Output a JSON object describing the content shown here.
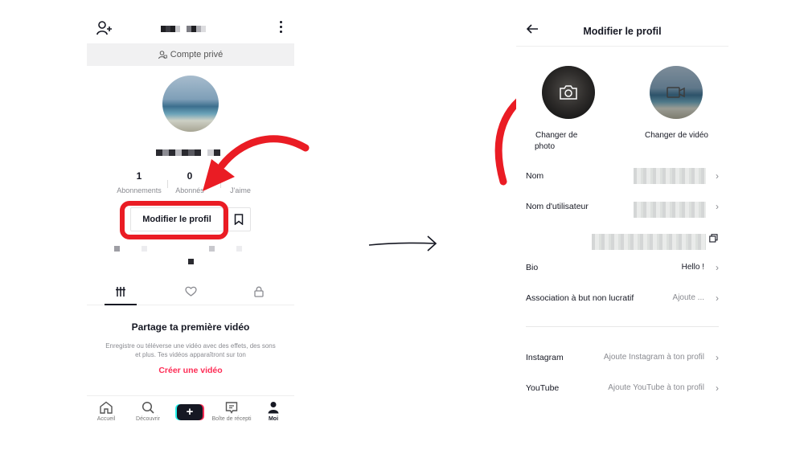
{
  "left": {
    "private_label": "Compte privé",
    "stats": [
      {
        "num": "1",
        "label": "Abonnements"
      },
      {
        "num": "0",
        "label": "Abonnés"
      },
      {
        "num": "",
        "label": "J'aime"
      }
    ],
    "edit_profile_label": "Modifier le profil",
    "empty_title": "Partage ta première vidéo",
    "empty_text": "Enregistre ou téléverse une vidéo avec des effets, des sons et plus. Tes vidéos apparaîtront sur ton",
    "create_link": "Créer une vidéo",
    "nav": [
      {
        "label": "Accueil",
        "icon": "home-icon"
      },
      {
        "label": "Découvrir",
        "icon": "search-icon"
      },
      {
        "label": "",
        "icon": "plus-icon"
      },
      {
        "label": "Boîte de récepti",
        "icon": "inbox-icon"
      },
      {
        "label": "Moi",
        "icon": "profile-icon"
      }
    ]
  },
  "right": {
    "title": "Modifier le profil",
    "change_photo_line1": "Changer de",
    "change_photo_line2": "photo",
    "change_video": "Changer de vidéo",
    "rows": {
      "name": "Nom",
      "username": "Nom d'utilisateur",
      "bio_label": "Bio",
      "bio_value": "Hello !",
      "nonprofit_label": "Association à but non lucratif",
      "nonprofit_value": "Ajoute ...",
      "instagram_label": "Instagram",
      "instagram_value": "Ajoute Instagram à ton profil",
      "youtube_label": "YouTube",
      "youtube_value": "Ajoute YouTube à ton profil"
    }
  },
  "colors": {
    "accent": "#fe2c55",
    "annotation_red": "#ea1c24",
    "text": "#161823",
    "muted": "#8a8b91"
  }
}
